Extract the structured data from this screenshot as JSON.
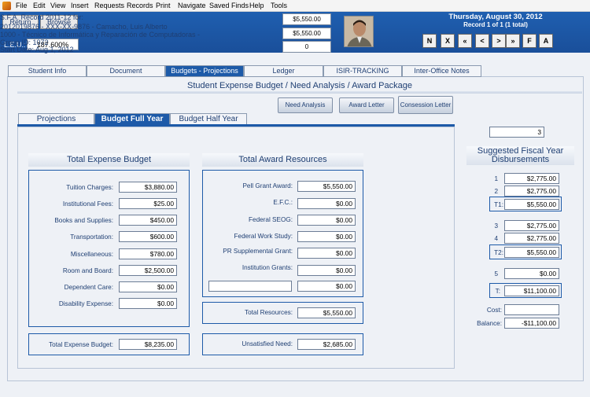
{
  "menu": [
    "File",
    "Edit",
    "View",
    "Insert",
    "Requests",
    "Records",
    "Print",
    "Navigate",
    "Saved Finds",
    "Help",
    "Tools"
  ],
  "header": {
    "return_label": "Return",
    "browse_label": "Browse",
    "leu_label": "L.E.U.:",
    "leu_value": "187.600%",
    "title": "S.F.A. Record 2011-12 for:",
    "student_line": "2012019876 - XXX-XX-9876 - Camacho, Luis Alberto",
    "program_line": "1000 - Técnico de Informática y Reparación de Computadoras -",
    "group_line": "Group ID: 1072",
    "start_line": "Start Date: Aug 1, 2012",
    "value1": "$5,550.00",
    "value2": "$5,550.00",
    "value3": "0",
    "date": "Thursday, August 30, 2012",
    "record_count": "Record 1 of 1 (1 total)",
    "nav_buttons": [
      "N",
      "X",
      "«",
      "<",
      ">",
      "»",
      "F",
      "A"
    ]
  },
  "tabs": [
    "Student Info",
    "Document",
    "Budgets - Projections",
    "Ledger",
    "ISIR-TRACKING",
    "Inter-Office Notes"
  ],
  "page_title": "Student Expense Budget / Need Analysis / Award Package",
  "actions": {
    "need_analysis": "Need Analysis",
    "award_letter": "Award Letter",
    "consession_letter": "Consession Letter"
  },
  "subtabs": [
    "Projections",
    "Budget Full Year",
    "Budget Half Year"
  ],
  "expense": {
    "heading": "Total Expense Budget",
    "rows": [
      {
        "label": "Tuition Charges:",
        "value": "$3,880.00"
      },
      {
        "label": "Institutional Fees:",
        "value": "$25.00"
      },
      {
        "label": "Books and Supplies:",
        "value": "$450.00"
      },
      {
        "label": "Transportation:",
        "value": "$600.00"
      },
      {
        "label": "Miscellaneous:",
        "value": "$780.00"
      },
      {
        "label": "Room and Board:",
        "value": "$2,500.00"
      },
      {
        "label": "Dependent Care:",
        "value": "$0.00"
      },
      {
        "label": "Disability Expense:",
        "value": "$0.00"
      }
    ],
    "total_label": "Total Expense Budget:",
    "total_value": "$8,235.00"
  },
  "award": {
    "heading": "Total Award Resources",
    "rows": [
      {
        "label": "Pell Grant Award:",
        "value": "$5,550.00"
      },
      {
        "label": "E.F.C.:",
        "value": "$0.00"
      },
      {
        "label": "Federal SEOG:",
        "value": "$0.00"
      },
      {
        "label": "Federal Work Study:",
        "value": "$0.00"
      },
      {
        "label": "PR Supplemental Grant:",
        "value": "$0.00"
      },
      {
        "label": "Institution Grants:",
        "value": "$0.00"
      }
    ],
    "extra_value": "$0.00",
    "total_label": "Total Resources:",
    "total_value": "$5,550.00",
    "unsatisfied_label": "Unsatisfied Need:",
    "unsatisfied_value": "$2,685.00"
  },
  "fiscal": {
    "count": "3",
    "heading": "Suggested Fiscal Year Disbursements",
    "d1_label": "1",
    "d1": "$2,775.00",
    "d2_label": "2",
    "d2": "$2,775.00",
    "t1_label": "T1:",
    "t1": "$5,550.00",
    "d3_label": "3",
    "d3": "$2,775.00",
    "d4_label": "4",
    "d4": "$2,775.00",
    "t2_label": "T2:",
    "t2": "$5,550.00",
    "d5_label": "5",
    "d5": "$0.00",
    "t_label": "T:",
    "t": "$11,100.00",
    "cost_label": "Cost:",
    "cost": "",
    "balance_label": "Balance:",
    "balance": "-$11,100.00"
  }
}
